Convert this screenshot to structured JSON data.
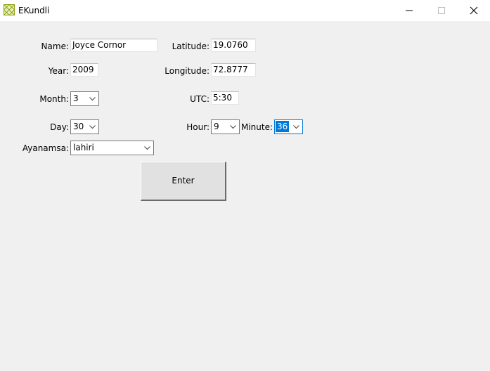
{
  "window": {
    "title": "EKundli",
    "icon": "ekundli-app-icon"
  },
  "form": {
    "name_label": "Name:",
    "name_value": "Joyce Cornor",
    "year_label": "Year:",
    "year_value": "2009",
    "month_label": "Month:",
    "month_value": "3",
    "day_label": "Day:",
    "day_value": "30",
    "ayanamsa_label": "Ayanamsa:",
    "ayanamsa_value": "lahiri",
    "latitude_label": "Latitude:",
    "latitude_value": "19.0760",
    "longitude_label": "Longitude:",
    "longitude_value": "72.8777",
    "utc_label": "UTC:",
    "utc_value": "5:30",
    "hour_label": "Hour:",
    "hour_value": "9",
    "minute_label": "Minute:",
    "minute_value": "36",
    "enter_label": "Enter"
  },
  "colors": {
    "accent": "#0078d7",
    "background": "#f0f0f0",
    "titlebar": "#ffffff"
  }
}
